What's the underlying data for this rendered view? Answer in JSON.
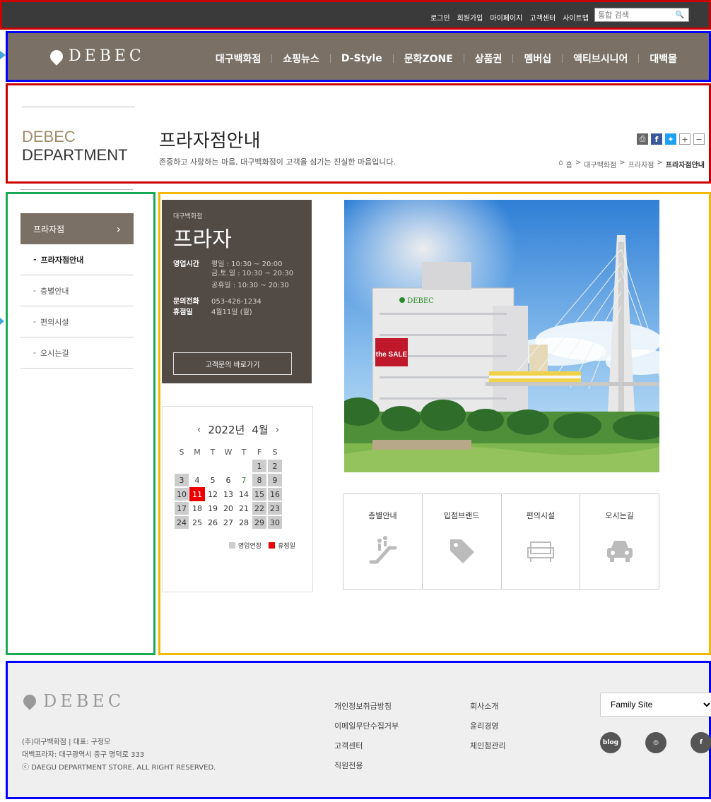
{
  "topbar": {
    "links": [
      "로그인",
      "회원가입",
      "마이페이지",
      "고객센터",
      "사이트맵"
    ],
    "search_placeholder": "통합 검색"
  },
  "nav": {
    "logo_text": "DEBEC",
    "items": [
      "대구백화점",
      "쇼핑뉴스",
      "D-Style",
      "문화ZONE",
      "상품권",
      "멤버십",
      "액티브시니어",
      "대백몰"
    ]
  },
  "header": {
    "brand_line1": "DEBEC",
    "brand_line2": "DEPARTMENT",
    "title": "프라자점안내",
    "subtitle": "존중하고 사랑하는 마음, 대구백화점이 고객을 섬기는 진실한 마음입니다.",
    "breadcrumb": [
      "홈",
      "대구백화점",
      "프라자점",
      "프라자점안내"
    ]
  },
  "sidebar": {
    "head": "프라자점",
    "items": [
      "프라자점안내",
      "층별안내",
      "편의시설",
      "오시는길"
    ]
  },
  "info": {
    "small": "대구백화점",
    "big": "프라자",
    "hours_label": "영업시간",
    "hours_weekday": "평일 : 10:30 ~ 20:00",
    "hours_weekend": "금.토.일 : 10:30 ~ 20:30",
    "hours_holiday": "공휴일 : 10:30 ~ 20:30",
    "phone_label": "문의전화",
    "phone": "053-426-1234",
    "closed_label": "휴점일",
    "closed": "4월11일 (월)",
    "button": "고객문의 바로가기"
  },
  "calendar": {
    "year": "2022년",
    "month": "4월",
    "prev": "‹",
    "next": "›",
    "dows": [
      "S",
      "M",
      "T",
      "W",
      "T",
      "F",
      "S"
    ],
    "weeks": [
      [
        "",
        "",
        "",
        "",
        "",
        "1",
        "2"
      ],
      [
        "3",
        "4",
        "5",
        "6",
        "7",
        "8",
        "9"
      ],
      [
        "10",
        "11",
        "12",
        "13",
        "14",
        "15",
        "16"
      ],
      [
        "17",
        "18",
        "19",
        "20",
        "21",
        "22",
        "23"
      ],
      [
        "24",
        "25",
        "26",
        "27",
        "28",
        "29",
        "30"
      ]
    ],
    "legend_extended": "영업연장",
    "legend_closed": "휴점일",
    "colors": {
      "extended": "#cccccc",
      "closed": "#ee0000"
    }
  },
  "tiles": [
    {
      "label": "층별안내",
      "icon": "escalator-icon"
    },
    {
      "label": "입점브랜드",
      "icon": "tag-icon"
    },
    {
      "label": "편의시설",
      "icon": "sofa-icon"
    },
    {
      "label": "오시는길",
      "icon": "car-icon"
    }
  ],
  "footer": {
    "logo_text": "DEBEC",
    "address_line1": "(주)대구백화점 | 대표: 구정모",
    "address_line2": "대백프라자: 대구광역시 중구 명덕로 333",
    "address_line3": "ⓒ DAEGU DEPARTMENT STORE. ALL RIGHT RESERVED.",
    "col1": [
      "개인정보취급방침",
      "이메일무단수집거부",
      "고객센터",
      "직원전용"
    ],
    "col2": [
      "회사소개",
      "윤리경영",
      "체인점관리"
    ],
    "family_site": "Family Site",
    "social": [
      "blog",
      "instagram",
      "facebook"
    ],
    "social_labels": {
      "blog": "blog",
      "instagram": "◎",
      "facebook": "f"
    }
  },
  "photo": {
    "sign": "DEBEC",
    "banner": "the SALE"
  }
}
